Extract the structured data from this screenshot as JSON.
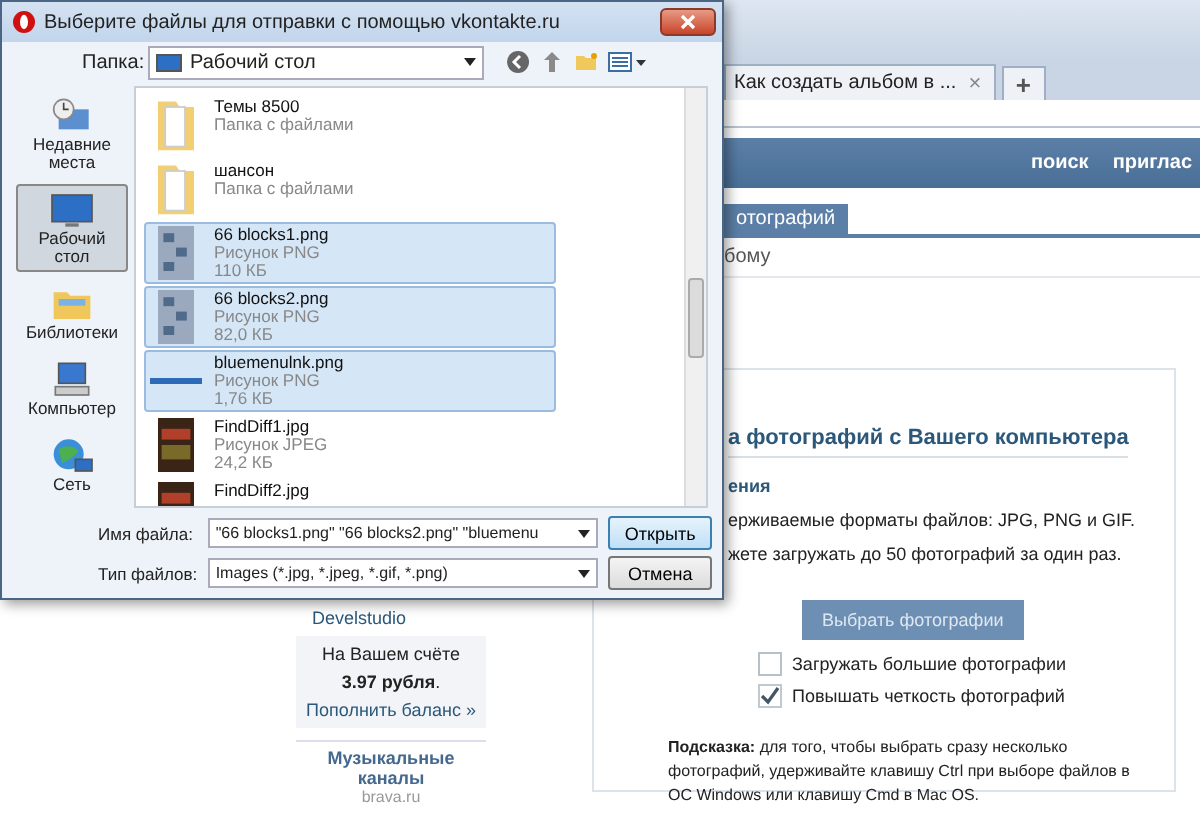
{
  "browser": {
    "tab_title": "Как создать альбом в ...",
    "tab_close": "×",
    "new_tab": "+",
    "header_links": [
      "поиск",
      "приглас"
    ],
    "page_tab": "отографий",
    "breadcrumb": "бому"
  },
  "sidebar": {
    "name": "Develstudio",
    "balance_label": "На Вашем счёте",
    "balance_amount": "3.97 рубля",
    "balance_dot": ".",
    "topup_link": "Пополнить баланс »",
    "promo_title": "Музыкальные каналы",
    "promo_site": "brava.ru"
  },
  "upload": {
    "heading": "а фотографий с Вашего компьютера",
    "section": "ения",
    "lines": [
      "ерживаемые форматы файлов:  JPG, PNG и GIF.",
      "жете загружать до 50 фотографий за один раз."
    ],
    "button": "Выбрать фотографии",
    "options": [
      {
        "label": "Загружать большие фотографии",
        "checked": false
      },
      {
        "label": "Повышать четкость фотографий",
        "checked": true
      }
    ],
    "hint": "**Подсказка:** для того, чтобы выбрать сразу несколько фотографий, удерживайте клавишу Ctrl при выборе файлов в ОС Windows или клавишу Cmd в Mac OS."
  },
  "dialog": {
    "title": "Выберите файлы для отправки с помощью vkontakte.ru",
    "folder_label": "Папка:",
    "folder_value": "Рабочий стол",
    "places": [
      {
        "label": "Недавние места",
        "kind": "recent",
        "selected": false
      },
      {
        "label": "Рабочий стол",
        "kind": "desktop",
        "selected": true
      },
      {
        "label": "Библиотеки",
        "kind": "libraries",
        "selected": false
      },
      {
        "label": "Компьютер",
        "kind": "computer",
        "selected": false
      },
      {
        "label": "Сеть",
        "kind": "network",
        "selected": false
      }
    ],
    "files": [
      {
        "name": "Темы 8500",
        "type": "Папка с файлами",
        "kind": "folder",
        "selected": false
      },
      {
        "name": "шансон",
        "type": "Папка с файлами",
        "kind": "folder",
        "selected": false
      },
      {
        "name": "66 blocks1.png",
        "type": "Рисунок PNG",
        "size": "110 КБ",
        "kind": "image",
        "selected": true
      },
      {
        "name": "66 blocks2.png",
        "type": "Рисунок PNG",
        "size": "82,0 КБ",
        "kind": "image",
        "selected": true
      },
      {
        "name": "bluemenulnk.png",
        "type": "Рисунок PNG",
        "size": "1,76 КБ",
        "kind": "strip",
        "selected": true
      },
      {
        "name": "FindDiff1.jpg",
        "type": "Рисунок JPEG",
        "size": "24,2 КБ",
        "kind": "photo",
        "selected": false
      },
      {
        "name": "FindDiff2.jpg",
        "kind": "photo",
        "selected": false
      }
    ],
    "filename_label": "Имя файла:",
    "filename_value": "\"66 blocks1.png\" \"66 blocks2.png\" \"bluemenu",
    "filetype_label": "Тип файлов:",
    "filetype_value": "Images (*.jpg, *.jpeg, *.gif, *.png)",
    "open_button": "Открыть",
    "cancel_button": "Отмена"
  }
}
